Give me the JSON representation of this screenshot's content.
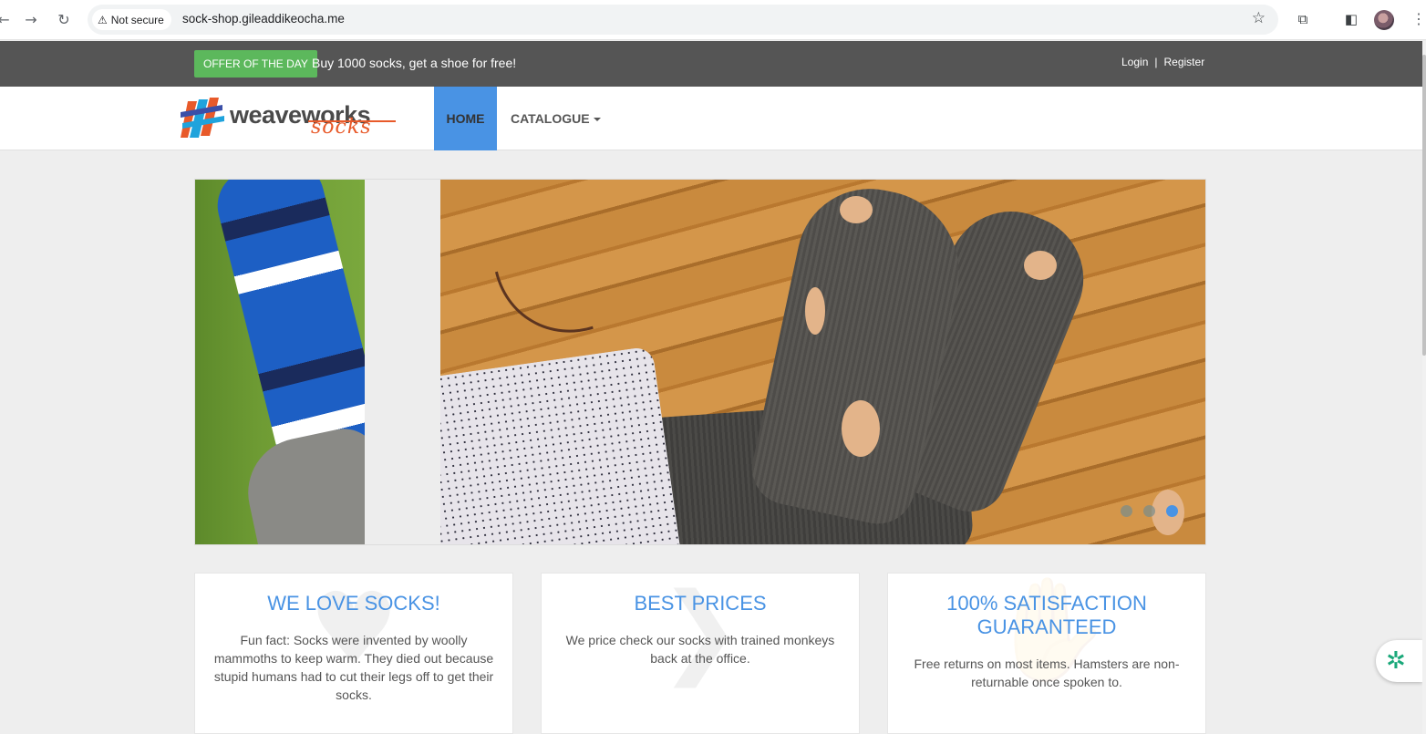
{
  "browser": {
    "back_icon": "back-arrow-icon",
    "forward_icon": "forward-arrow-icon",
    "reload_icon": "reload-icon",
    "security_label": "Not secure",
    "url": "sock-shop.gileaddikeocha.me"
  },
  "top_bar": {
    "offer_badge": "OFFER OF THE DAY",
    "offer_text": "Buy 1000 socks, get a shoe for free!",
    "login": "Login",
    "separator": "|",
    "register": "Register"
  },
  "navbar": {
    "logo_primary": "weaveworks",
    "logo_secondary": "socks",
    "home": "HOME",
    "catalogue": "CATALOGUE"
  },
  "carousel": {
    "slide_count": 3,
    "active_index": 2
  },
  "features": [
    {
      "title": "WE LOVE SOCKS!",
      "text": "Fun fact: Socks were invented by woolly mammoths to keep warm. They died out because stupid humans had to cut their legs off to get their socks."
    },
    {
      "title": "BEST PRICES",
      "text": "We price check our socks with trained monkeys back at the office."
    },
    {
      "title": "100% SATISFACTION GUARANTEED",
      "text": "Free returns on most items. Hamsters are non-returnable once spoken to."
    }
  ],
  "colors": {
    "accent": "#4993e4",
    "offer_green": "#5cb85c",
    "top_bar": "#555555",
    "logo_orange": "#e85a2a"
  }
}
